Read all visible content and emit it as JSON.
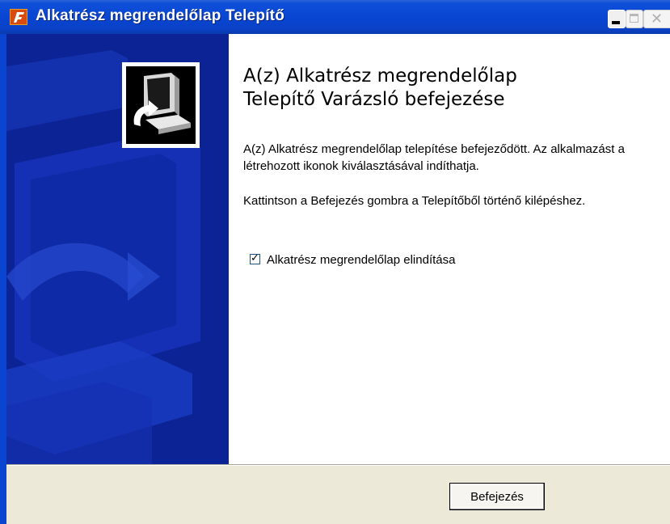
{
  "window": {
    "title": "Alkatrész megrendelőlap Telepítő",
    "icon": "installer-app-icon",
    "controls": [
      "minimize-icon",
      "maximize-icon",
      "close-icon"
    ]
  },
  "banner": {
    "logo": "installer-computer-icon"
  },
  "content": {
    "heading_line1": "A(z) Alkatrész megrendelőlap",
    "heading_line2": "Telepítő Varázsló befejezése",
    "paragraph1": "A(z) Alkatrész megrendelőlap telepítése befejeződött. Az alkalmazást a létrehozott ikonok kiválasztásával indíthatja.",
    "paragraph2": "Kattintson a Befejezés gombra a Telepítőből történő kilépéshez.",
    "checkbox": {
      "label": "Alkatrész megrendelőlap elindítása",
      "checked": true
    }
  },
  "footer": {
    "finish_label": "Befejezés"
  },
  "colors": {
    "titlebar": "#0846d3",
    "banner": "#0b2395",
    "footer_bg": "#ECE9D8"
  }
}
